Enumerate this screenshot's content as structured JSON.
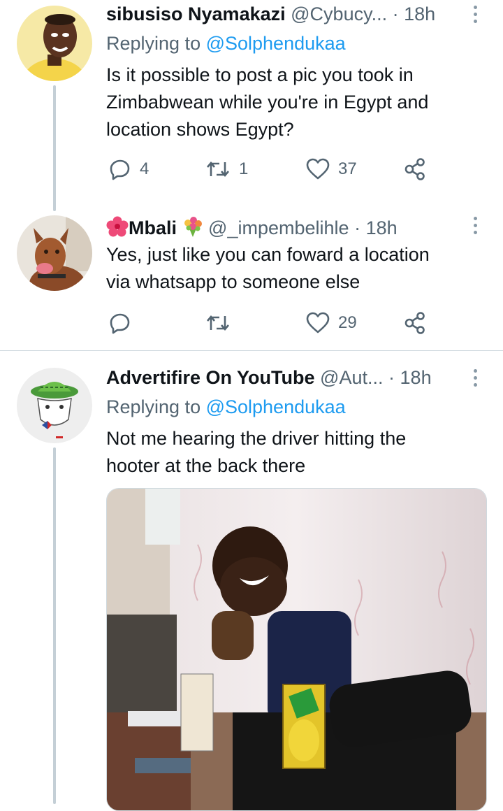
{
  "tweets": [
    {
      "name": "sibusiso Nyamakazi",
      "handle": "@Cybucy...",
      "dot": "·",
      "time": "18h",
      "replying_prefix": "Replying to ",
      "replying_handle": "@Solphendukaa",
      "text_lines": [
        "Is it possible to post a pic you took in",
        "Zimbabwean while you're in Egypt and",
        "location shows Egypt?"
      ],
      "reply_count": "4",
      "retweet_count": "1",
      "like_count": "37"
    },
    {
      "name": "Mbali",
      "handle": "@_impembelihle",
      "dot": "·",
      "time": "18h",
      "text_lines": [
        "Yes, just like you can foward a location",
        "via whatsapp to someone else"
      ],
      "reply_count": "",
      "retweet_count": "",
      "like_count": "29"
    },
    {
      "name": "Advertifire On YouTube",
      "handle": "@Aut...",
      "dot": "·",
      "time": "18h",
      "replying_prefix": "Replying to ",
      "replying_handle": "@Solphendukaa",
      "text_lines": [
        "Not me hearing the driver hitting the",
        "hooter at the back there"
      ]
    }
  ],
  "icons": {
    "reply": "reply-icon",
    "retweet": "retweet-icon",
    "like": "heart-icon",
    "share": "share-icon",
    "more": "more-vertical-icon"
  },
  "colors": {
    "text": "#0f1419",
    "secondary": "#536471",
    "accent": "#1d9bf0",
    "thread": "#c4cfd6"
  }
}
